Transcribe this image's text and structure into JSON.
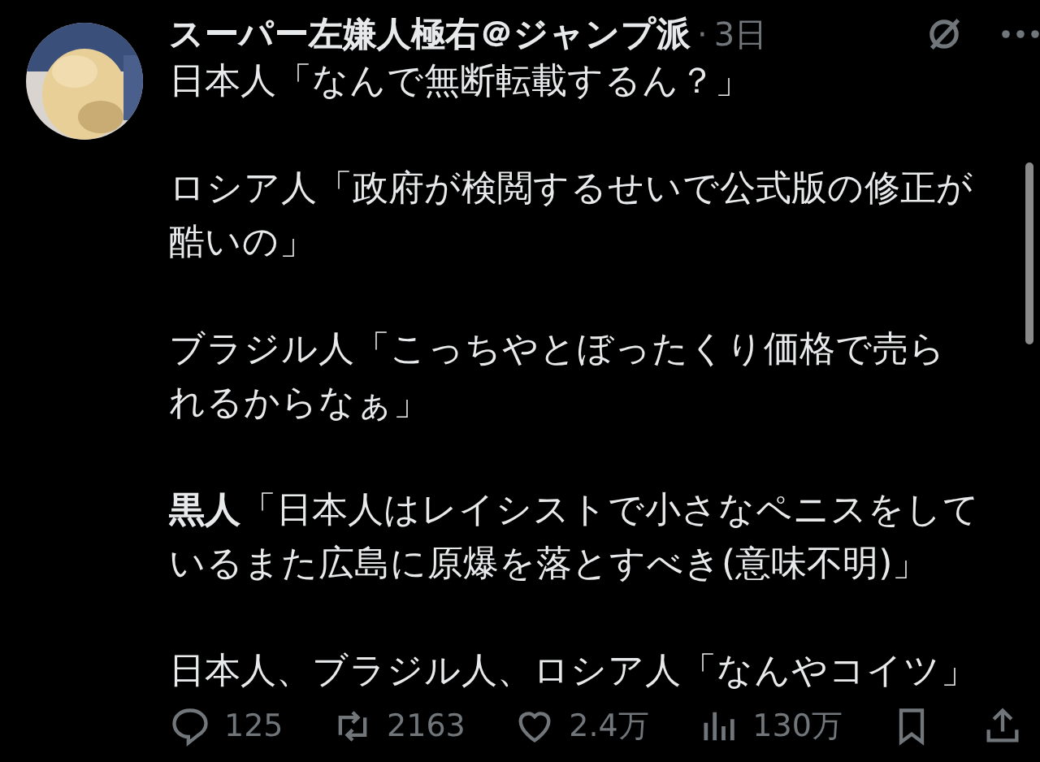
{
  "post": {
    "author": "スーパー左嫌人極右＠ジャンプ派",
    "separator": "·",
    "time": "3日",
    "paragraphs": [
      "日本人「なんで無断転載するん？」",
      "ロシア人「政府が検閲するせいで公式版の修正が酷いの」",
      "ブラジル人「こっちやとぼったくり価格で売られるからなぁ」",
      "**黒人**「日本人はレイシストで小さなペニスをしているまた広島に原爆を落とすべき(意味不明)」",
      "日本人、ブラジル人、ロシア人「なんやコイツ」"
    ],
    "actions": [
      {
        "kind": "reply",
        "count": "125"
      },
      {
        "kind": "repost",
        "count": "2163"
      },
      {
        "kind": "like",
        "count": "2.4万"
      },
      {
        "kind": "views",
        "count": "130万"
      },
      {
        "kind": "bookmark"
      },
      {
        "kind": "share"
      }
    ]
  }
}
